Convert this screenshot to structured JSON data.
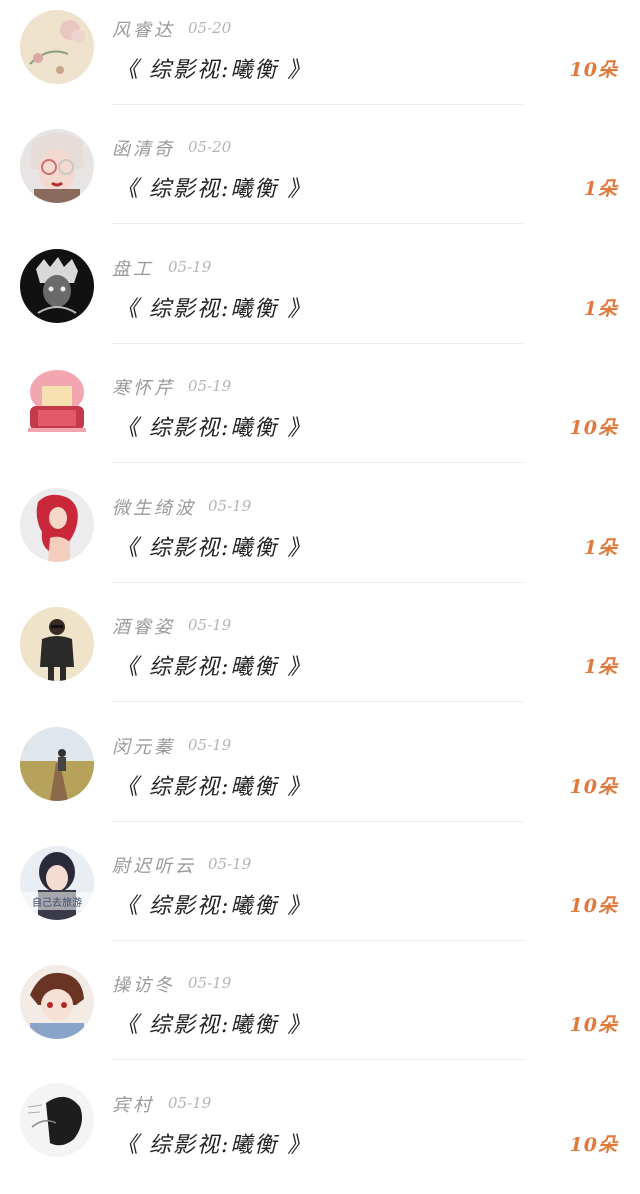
{
  "records": [
    {
      "name": "风睿达",
      "date": "05-20",
      "title": "《 综影视:曦衡 》",
      "gift": "10朵",
      "avatar": "floral-avatar"
    },
    {
      "name": "函清奇",
      "date": "05-20",
      "title": "《 综影视:曦衡 》",
      "gift": "1朵",
      "avatar": "girl-glasses-avatar"
    },
    {
      "name": "盘工",
      "date": "05-19",
      "title": "《 综影视:曦衡 》",
      "gift": "1朵",
      "avatar": "dark-portrait-avatar"
    },
    {
      "name": "寒怀芹",
      "date": "05-19",
      "title": "《 综影视:曦衡 》",
      "gift": "10朵",
      "avatar": "pink-hair-avatar"
    },
    {
      "name": "微生绮波",
      "date": "05-19",
      "title": "《 综影视:曦衡 》",
      "gift": "1朵",
      "avatar": "red-hair-avatar"
    },
    {
      "name": "酒睿姿",
      "date": "05-19",
      "title": "《 综影视:曦衡 》",
      "gift": "1朵",
      "avatar": "man-suit-avatar"
    },
    {
      "name": "闵元蓁",
      "date": "05-19",
      "title": "《 综影视:曦衡 》",
      "gift": "10朵",
      "avatar": "boardwalk-avatar"
    },
    {
      "name": "尉迟听云",
      "date": "05-19",
      "title": "《 综影视:曦衡 》",
      "gift": "10朵",
      "avatar": "girl-hood-avatar"
    },
    {
      "name": "操访冬",
      "date": "05-19",
      "title": "《 综影视:曦衡 》",
      "gift": "10朵",
      "avatar": "anime-boy-avatar"
    },
    {
      "name": "宾村",
      "date": "05-19",
      "title": "《 综影视:曦衡 》",
      "gift": "10朵",
      "avatar": "sketch-avatar"
    }
  ],
  "avatar_text": {
    "girl_hood": "自己去旅游"
  },
  "colors": {
    "name": "#9a9a9a",
    "date": "#b4b4b4",
    "title": "#222222",
    "gift": "#e1793d",
    "divider": "#ededed"
  }
}
